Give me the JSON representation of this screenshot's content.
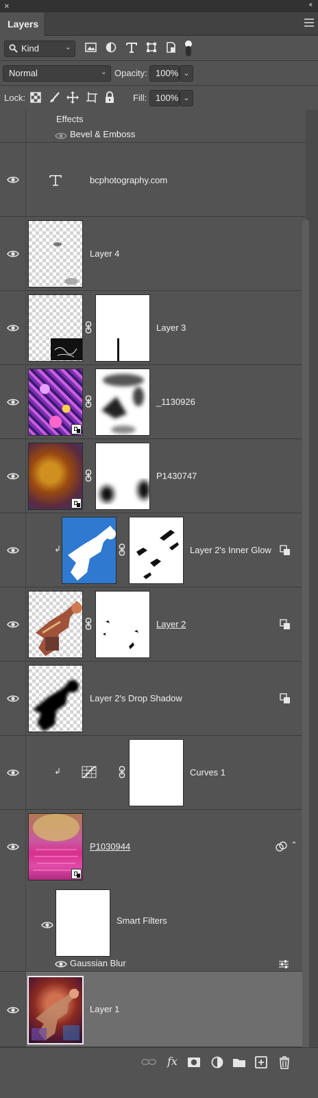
{
  "panel": {
    "title": "Layers",
    "close_glyph": "×",
    "collapse_glyph": "‹‹"
  },
  "filter": {
    "kind_label": "Kind",
    "icons": [
      "image-filter-icon",
      "adjustment-filter-icon",
      "type-filter-icon",
      "shape-filter-icon",
      "smart-object-filter-icon",
      "filter-toggle"
    ]
  },
  "blend": {
    "mode": "Normal",
    "opacity_label": "Opacity:",
    "opacity_value": "100%"
  },
  "lock": {
    "label": "Lock:",
    "fill_label": "Fill:",
    "fill_value": "100%",
    "icons": [
      "lock-transparent-icon",
      "lock-image-icon",
      "lock-position-icon",
      "lock-artboard-icon",
      "lock-all-icon"
    ]
  },
  "layers": [
    {
      "type": "effects",
      "effects_label": "Effects",
      "effect": "Bevel & Emboss"
    },
    {
      "type": "text",
      "name": "bcphotography.com"
    },
    {
      "type": "pixel",
      "name": "Layer 4"
    },
    {
      "type": "masked",
      "name": "Layer 3"
    },
    {
      "type": "masked-smart",
      "name": "_1130926"
    },
    {
      "type": "masked-smart",
      "name": "P1430747"
    },
    {
      "type": "masked-clipped",
      "name": "Layer 2's Inner Glow"
    },
    {
      "type": "masked",
      "name": "Layer 2"
    },
    {
      "type": "pixel",
      "name": "Layer 2's Drop Shadow"
    },
    {
      "type": "adjustment",
      "name": "Curves 1"
    },
    {
      "type": "smart",
      "name": "P1030944",
      "smart_filters": "Smart Filters",
      "filter": "Gaussian Blur"
    },
    {
      "type": "pixel",
      "name": "Layer 1",
      "active": true
    }
  ],
  "bottom_icons": [
    "link-layers-icon",
    "fx-icon",
    "add-mask-icon",
    "new-adjustment-icon",
    "new-group-icon",
    "new-layer-icon",
    "delete-layer-icon"
  ],
  "fx_label": "fx"
}
